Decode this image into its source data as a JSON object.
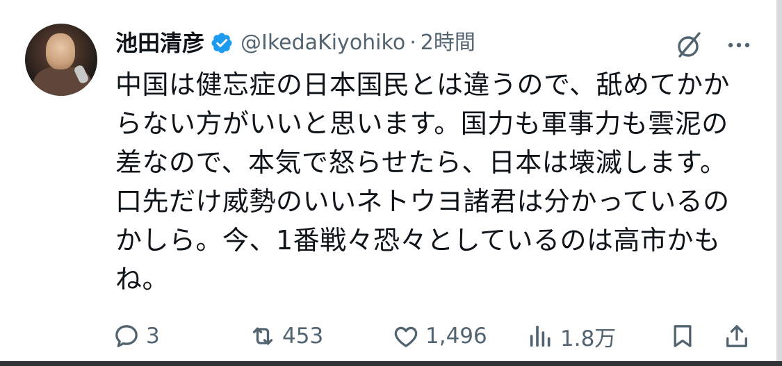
{
  "post": {
    "author_name": "池田清彦",
    "handle": "@IkedaKiyohiko",
    "separator": "·",
    "time": "2時間",
    "verified": true,
    "text": "中国は健忘症の日本国民とは違うので、舐めてかか\nらない方がいいと思います。国力も軍事力も雲泥の\n差なので、本気で怒らせたら、日本は壊滅します。\n口先だけ威勢のいいネトウヨ諸君は分かっているの\nかしら。今、1番戦々恐々としているのは高市かも\nね。"
  },
  "actions": {
    "replies": "3",
    "reposts": "453",
    "likes": "1,496",
    "views": "1.8万"
  },
  "icons": {
    "verified": "verified-badge-icon",
    "grok": "grok-icon",
    "more": "more-icon",
    "reply": "reply-icon",
    "repost": "repost-icon",
    "like": "like-icon",
    "views": "views-icon",
    "bookmark": "bookmark-icon",
    "share": "share-icon"
  },
  "colors": {
    "text": "#0f1419",
    "secondary": "#536471",
    "verified": "#1d9bf0"
  }
}
